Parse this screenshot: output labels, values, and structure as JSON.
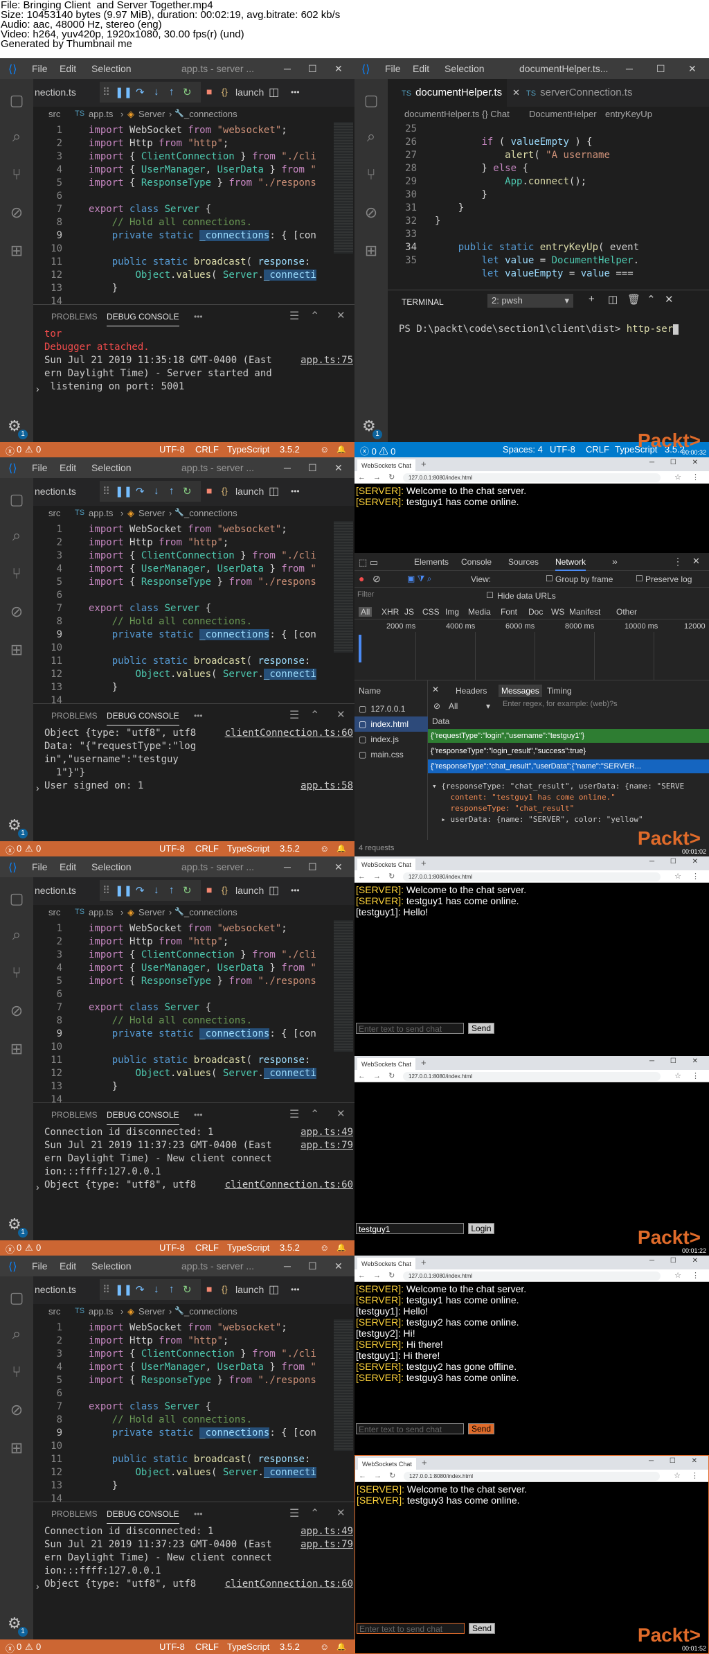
{
  "header": {
    "lines": [
      "File: Bringing Client  and Server Together.mp4",
      "Size: 10453140 bytes (9.97 MiB), duration: 00:02:19, avg.bitrate: 602 kb/s",
      "Audio: aac, 48000 Hz, stereo (eng)",
      "Video: h264, yuv420p, 1920x1080, 30.00 fps(r) (und)",
      "Generated by Thumbnail me"
    ]
  },
  "colors": {
    "status": "#cc6633",
    "accent": "#0e639c",
    "packt": "#e06b2a",
    "server": "#ffd43b"
  },
  "vscode": {
    "menu": [
      "File",
      "Edit",
      "Selection"
    ],
    "window_title": "app.ts - server ...",
    "tab_partial": "nection.ts",
    "launch_tab": "launch",
    "breadcrumb": {
      "src": "src",
      "file": "app.ts",
      "cls": "Server",
      "member": "_connections"
    },
    "line_numbers": [
      "1",
      "2",
      "3",
      "4",
      "5",
      "6",
      "7",
      "8",
      "9",
      "10",
      "11",
      "12",
      "13",
      "14"
    ],
    "code": [
      {
        "t": [
          [
            "kw2",
            "import "
          ],
          [
            "",
            "WebSocket "
          ],
          [
            "kw2",
            "from "
          ],
          [
            "str",
            "\"websocket\""
          ],
          [
            "",
            ";"
          ]
        ]
      },
      {
        "t": [
          [
            "kw2",
            "import "
          ],
          [
            "",
            "Http "
          ],
          [
            "kw2",
            "from "
          ],
          [
            "str",
            "\"http\""
          ],
          [
            "",
            ";"
          ]
        ]
      },
      {
        "t": [
          [
            "kw2",
            "import "
          ],
          [
            "",
            "{ "
          ],
          [
            "cls",
            "ClientConnection"
          ],
          [
            "",
            " } "
          ],
          [
            "kw2",
            "from "
          ],
          [
            "str",
            "\"./cli"
          ]
        ]
      },
      {
        "t": [
          [
            "kw2",
            "import "
          ],
          [
            "",
            "{ "
          ],
          [
            "cls",
            "UserManager"
          ],
          [
            "",
            ", "
          ],
          [
            "cls",
            "UserData"
          ],
          [
            "",
            " } "
          ],
          [
            "kw2",
            "from "
          ],
          [
            "str",
            "\""
          ]
        ]
      },
      {
        "t": [
          [
            "kw2",
            "import "
          ],
          [
            "",
            "{ "
          ],
          [
            "cls",
            "ResponseType"
          ],
          [
            "",
            " } "
          ],
          [
            "kw2",
            "from "
          ],
          [
            "str",
            "\"./respons"
          ]
        ]
      },
      {
        "t": []
      },
      {
        "t": [
          [
            "kw2",
            "export "
          ],
          [
            "kw",
            "class "
          ],
          [
            "cls",
            "Server"
          ],
          [
            "",
            " {"
          ]
        ]
      },
      {
        "t": [
          [
            "",
            "    "
          ],
          [
            "cm",
            "// Hold all connections."
          ]
        ]
      },
      {
        "t": [
          [
            "",
            "    "
          ],
          [
            "kw",
            "private static "
          ],
          [
            "hl vr",
            "_connections"
          ],
          [
            "",
            ": { [con"
          ]
        ]
      },
      {
        "t": []
      },
      {
        "t": [
          [
            "",
            "    "
          ],
          [
            "kw",
            "public static "
          ],
          [
            "fn",
            "broadcast"
          ],
          [
            "",
            "( "
          ],
          [
            "vr",
            "response"
          ],
          [
            "",
            ":"
          ]
        ]
      },
      {
        "t": [
          [
            "",
            "        "
          ],
          [
            "cls",
            "Object"
          ],
          [
            "",
            "."
          ],
          [
            "fn",
            "values"
          ],
          [
            "",
            "( "
          ],
          [
            "cls",
            "Server"
          ],
          [
            "",
            "."
          ],
          [
            "hl vr",
            "_connecti"
          ]
        ]
      },
      {
        "t": [
          [
            "",
            "    }"
          ]
        ]
      },
      {
        "t": []
      }
    ],
    "tabs": {
      "problems": "PROBLEMS",
      "debug": "DEBUG CONSOLE",
      "more": "•••"
    },
    "status": {
      "errors": "0",
      "warnings": "0",
      "encoding": "UTF-8",
      "eol": "CRLF",
      "lang": "TypeScript",
      "version": "3.5.2"
    }
  },
  "frame1": {
    "console": [
      {
        "text": "tor",
        "color": "#f14c4c"
      },
      {
        "text": "Debugger attached.",
        "color": "#f14c4c"
      },
      {
        "text": "Sun Jul 21 2019 11:35:18 GMT-0400 (East",
        "color": "#ccc"
      },
      {
        "text": "ern Daylight Time) - Server started and",
        "color": "#ccc"
      },
      {
        "text": " listening on port: 5001",
        "color": "#ccc"
      }
    ],
    "link": "app.ts:75",
    "right": {
      "menu": [
        "File",
        "Edit",
        "Selection"
      ],
      "title": "documentHelper.ts...",
      "tab_active": "documentHelper.ts",
      "tab_other": "serverConnection.ts",
      "crumbs": [
        "documentHelper.ts",
        "{} Chat",
        "DocumentHelper",
        "entryKeyUp"
      ],
      "line_numbers": [
        "25",
        "26",
        "27",
        "28",
        "29",
        "30",
        "31",
        "32",
        "33",
        "34",
        "35"
      ],
      "code": [
        [
          [
            "",
            ""
          ]
        ],
        [
          [
            "",
            "        "
          ],
          [
            "kw2",
            "if"
          ],
          [
            "",
            " ( "
          ],
          [
            "vr",
            "valueEmpty"
          ],
          [
            "",
            " ) {"
          ]
        ],
        [
          [
            "",
            "            "
          ],
          [
            "fn",
            "alert"
          ],
          [
            "",
            "( "
          ],
          [
            "str",
            "\"A username"
          ]
        ],
        [
          [
            "",
            "        } "
          ],
          [
            "kw2",
            "else"
          ],
          [
            "",
            " {"
          ]
        ],
        [
          [
            "",
            "            "
          ],
          [
            "cls",
            "App"
          ],
          [
            "",
            "."
          ],
          [
            "fn",
            "connect"
          ],
          [
            "",
            "();"
          ]
        ],
        [
          [
            "",
            "        }"
          ]
        ],
        [
          [
            "",
            "    }"
          ]
        ],
        [
          [
            "",
            "}"
          ]
        ],
        [
          [
            "",
            ""
          ]
        ],
        [
          [
            "",
            "    "
          ],
          [
            "kw",
            "public static "
          ],
          [
            "fn",
            "entryKeyUp"
          ],
          [
            "",
            "( event"
          ]
        ],
        [
          [
            "",
            "        "
          ],
          [
            "kw",
            "let "
          ],
          [
            "vr",
            "value"
          ],
          [
            "",
            " = "
          ],
          [
            "cls",
            "DocumentHelper"
          ],
          [
            "",
            "."
          ]
        ],
        [
          [
            "",
            "        "
          ],
          [
            "kw",
            "let "
          ],
          [
            "vr",
            "valueEmpty"
          ],
          [
            "",
            " = "
          ],
          [
            "vr",
            "value"
          ],
          [
            "",
            " ==="
          ]
        ]
      ],
      "terminal_label": "TERMINAL",
      "terminal_select": "2: pwsh",
      "prompt": "PS D:\\packt\\code\\section1\\client\\dist>",
      "command": "http-ser",
      "status": {
        "spaces": "Spaces: 4",
        "encoding": "UTF-8",
        "eol": "CRLF",
        "lang": "TypeScript",
        "version": "3.5.2"
      }
    },
    "timestamp": "00:00:32"
  },
  "frame2": {
    "console": [
      {
        "text": "Object {type: \"utf8\", utf8",
        "color": "#ccc"
      },
      {
        "text": "Data: \"{\"requestType\":\"log",
        "color": "#ccc"
      },
      {
        "text": "in\",\"username\":\"testguy",
        "color": "#ccc"
      },
      {
        "text": "  1\"}\"}",
        "color": "#ccc"
      },
      {
        "text": "User signed on: 1",
        "color": "#ccc"
      }
    ],
    "link1": "clientConnection.ts:60",
    "link2": "app.ts:58",
    "tab_title": "WebSockets Chat",
    "url": "127.0.0.1:8080/index.html",
    "messages": [
      [
        "[SERVER]:",
        " Welcome to the chat server."
      ],
      [
        "[SERVER]:",
        " testguy1 has come online."
      ]
    ],
    "devtools": {
      "tabs": [
        "Elements",
        "Console",
        "Sources",
        "Network"
      ],
      "view_label": "View:",
      "group": "Group by frame",
      "preserve": "Preserve log",
      "filter": "Filter",
      "hide_data": "Hide data URLs",
      "types": [
        "All",
        "XHR",
        "JS",
        "CSS",
        "Img",
        "Media",
        "Font",
        "Doc",
        "WS",
        "Manifest",
        "Other"
      ],
      "times": [
        "2000 ms",
        "4000 ms",
        "6000 ms",
        "8000 ms",
        "10000 ms",
        "12000"
      ],
      "name_header": "Name",
      "sub_tabs": [
        "Headers",
        "Messages",
        "Timing"
      ],
      "names": [
        "127.0.0.1",
        "index.html",
        "index.js",
        "main.css"
      ],
      "msg_filter": "All",
      "regex_placeholder": "Enter regex, for example: (web)?s",
      "data_header": "Data",
      "frames": [
        "{\"requestType\":\"login\",\"username\":\"testguy1\"}",
        "{\"responseType\":\"login_result\",\"success\":true}",
        "{\"responseType\":\"chat_result\",\"userData\":{\"name\":\"SERVER..."
      ],
      "detail": [
        "▾ {responseType: \"chat_result\", userData: {name: \"SERVE",
        "    content: \"testguy1 has come online.\"",
        "    responseType: \"chat_result\"",
        "  ▸ userData: {name: \"SERVER\", color: \"yellow\""
      ],
      "requests": "4 requests"
    },
    "timestamp": "00:01:02"
  },
  "frame3": {
    "console": [
      {
        "text": "Connection id disconnected: 1",
        "color": "#ccc"
      },
      {
        "text": "Sun Jul 21 2019 11:37:23 GMT-0400 (East",
        "color": "#ccc"
      },
      {
        "text": "ern Daylight Time) - New client connect",
        "color": "#ccc"
      },
      {
        "text": "ion:::ffff:127.0.0.1",
        "color": "#ccc"
      },
      {
        "text": "Object {type: \"utf8\", utf8",
        "color": "#ccc"
      }
    ],
    "links": [
      "app.ts:49",
      "app.ts:79",
      "clientConnection.ts:60"
    ],
    "chat_top": [
      [
        "[SERVER]:",
        " Welcome to the chat server."
      ],
      [
        "[SERVER]:",
        " testguy1 has come online."
      ],
      [
        "[testguy1]:",
        " Hello!"
      ]
    ],
    "input_placeholder": "Enter text to send chat",
    "send": "Send",
    "login_value": "testguy1",
    "login": "Login",
    "timestamp": "00:01:22"
  },
  "frame4": {
    "chat_top": [
      [
        "[SERVER]:",
        " Welcome to the chat server."
      ],
      [
        "[SERVER]:",
        " testguy1 has come online."
      ],
      [
        "[testguy1]:",
        " Hello!"
      ],
      [
        "[SERVER]:",
        " testguy2 has come online."
      ],
      [
        "[testguy2]:",
        " Hi!"
      ],
      [
        "[SERVER]:",
        " Hi there!"
      ],
      [
        "[testguy1]:",
        " Hi there!"
      ],
      [
        "[SERVER]:",
        " testguy2 has gone offline."
      ],
      [
        "[SERVER]:",
        " testguy3 has come online."
      ]
    ],
    "chat_bottom": [
      [
        "[SERVER]:",
        " Welcome to the chat server."
      ],
      [
        "[SERVER]:",
        " testguy3 has come online."
      ]
    ],
    "timestamp": "00:01:52"
  },
  "packt": "Packt>"
}
